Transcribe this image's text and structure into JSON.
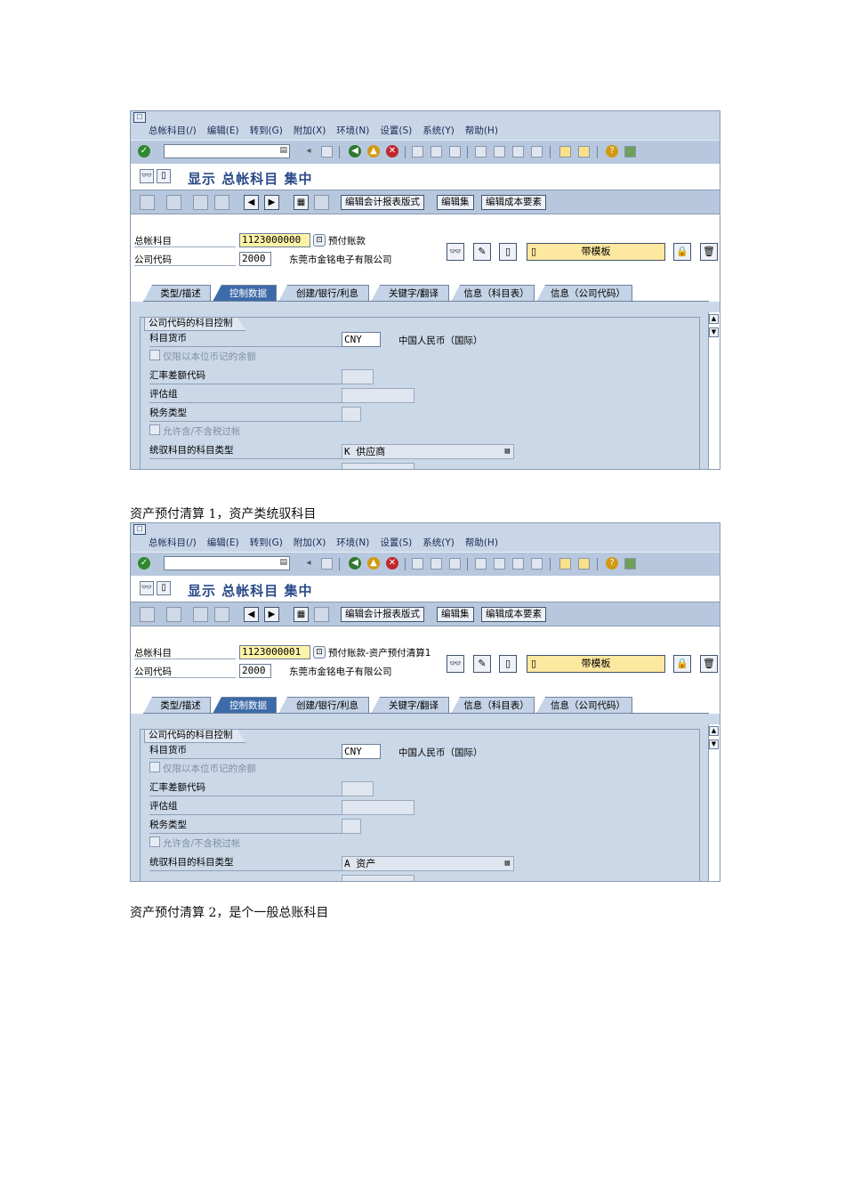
{
  "screens": [
    {
      "menu": [
        "总帐科目(/)",
        "编辑(E)",
        "转到(G)",
        "附加(X)",
        "环境(N)",
        "设置(S)",
        "系统(Y)",
        "帮助(H)"
      ],
      "title": "显示 总帐科目 集中",
      "app_buttons": [
        "编辑会计报表版式",
        "编辑集",
        "编辑成本要素"
      ],
      "gl_account_label": "总帐科目",
      "gl_account_value": "1123000000",
      "gl_account_desc": "预付账款",
      "company_code_label": "公司代码",
      "company_code_value": "2000",
      "company_name": "东莞市金铭电子有限公司",
      "template_button": "带模板",
      "tabs": [
        "类型/描述",
        "控制数据",
        "创建/银行/利息",
        "关键字/翻译",
        "信息（科目表）",
        "信息（公司代码）"
      ],
      "active_tab": 1,
      "group_title": "公司代码的科目控制",
      "fields": {
        "currency_label": "科目货币",
        "currency_value": "CNY",
        "currency_desc": "中国人民币（国际）",
        "local_balance_label": "仅限以本位币记的余额",
        "exch_diff_label": "汇率差额代码",
        "valuation_label": "评估组",
        "tax_label": "税务类型",
        "tax_allow_label": "允许含/不含税过帐",
        "recon_label": "统驭科目的科目类型",
        "recon_value": "K 供应商"
      },
      "icons": [
        "check-icon",
        "back-icon",
        "exit-icon",
        "cancel-icon",
        "help-icon"
      ]
    },
    {
      "menu": [
        "总帐科目(/)",
        "编辑(E)",
        "转到(G)",
        "附加(X)",
        "环境(N)",
        "设置(S)",
        "系统(Y)",
        "帮助(H)"
      ],
      "title": "显示 总帐科目 集中",
      "app_buttons": [
        "编辑会计报表版式",
        "编辑集",
        "编辑成本要素"
      ],
      "gl_account_label": "总帐科目",
      "gl_account_value": "1123000001",
      "gl_account_desc": "预付账款-资产预付清算1",
      "company_code_label": "公司代码",
      "company_code_value": "2000",
      "company_name": "东莞市金铭电子有限公司",
      "template_button": "带模板",
      "tabs": [
        "类型/描述",
        "控制数据",
        "创建/银行/利息",
        "关键字/翻译",
        "信息（科目表）",
        "信息（公司代码）"
      ],
      "active_tab": 1,
      "group_title": "公司代码的科目控制",
      "fields": {
        "currency_label": "科目货币",
        "currency_value": "CNY",
        "currency_desc": "中国人民币（国际）",
        "local_balance_label": "仅限以本位币记的余额",
        "exch_diff_label": "汇率差额代码",
        "valuation_label": "评估组",
        "tax_label": "税务类型",
        "tax_allow_label": "允许含/不含税过帐",
        "recon_label": "统驭科目的科目类型",
        "recon_value": "A 资产"
      },
      "icons": [
        "check-icon",
        "back-icon",
        "exit-icon",
        "cancel-icon",
        "help-icon"
      ]
    }
  ],
  "captions": [
    "资产预付清算 1，资产类统驭科目",
    "资产预付清算 2，是个一般总账科目"
  ],
  "colors": {
    "toolbar": "#b7c8de",
    "active_tab": "#3d6aa8",
    "required_field": "#fdf3a8",
    "title_text": "#2a4a88"
  }
}
